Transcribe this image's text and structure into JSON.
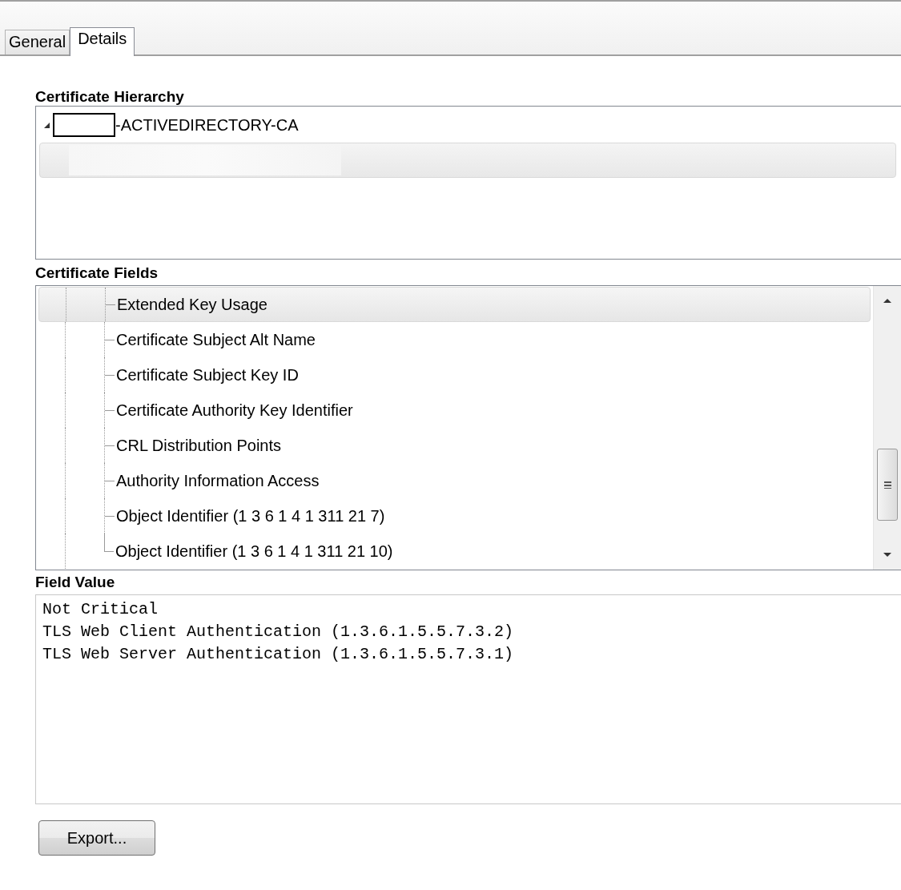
{
  "tabs": [
    {
      "label": "General",
      "selected": false
    },
    {
      "label": "Details",
      "selected": true
    }
  ],
  "hierarchy": {
    "label": "Certificate Hierarchy",
    "items": [
      {
        "label": "-ACTIVEDIRECTORY-CA",
        "expanded": true,
        "redacted": true,
        "selected": false
      },
      {
        "redacted": true,
        "selected": true
      }
    ]
  },
  "fields": {
    "label": "Certificate Fields",
    "items": [
      {
        "label": "Extended Key Usage",
        "selected": true
      },
      {
        "label": "Certificate Subject Alt Name",
        "selected": false
      },
      {
        "label": "Certificate Subject Key ID",
        "selected": false
      },
      {
        "label": "Certificate Authority Key Identifier",
        "selected": false
      },
      {
        "label": "CRL Distribution Points",
        "selected": false
      },
      {
        "label": "Authority Information Access",
        "selected": false
      },
      {
        "label": "Object Identifier (1 3 6 1 4 1 311 21 7)",
        "selected": false
      },
      {
        "label": "Object Identifier (1 3 6 1 4 1 311 21 10)",
        "selected": false
      }
    ]
  },
  "field_value": {
    "label": "Field Value",
    "lines": [
      "Not Critical",
      "TLS Web Client Authentication (1.3.6.1.5.5.7.3.2)",
      "TLS Web Server Authentication (1.3.6.1.5.5.7.3.1)"
    ]
  },
  "buttons": [
    {
      "label": "Export..."
    }
  ]
}
